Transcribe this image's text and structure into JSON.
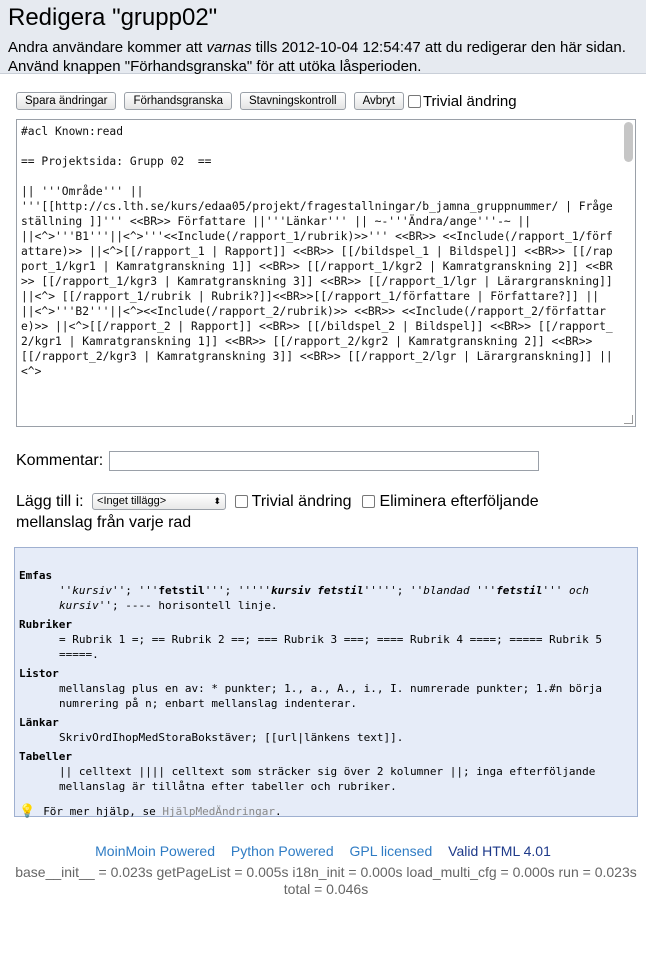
{
  "header": {
    "title": "Redigera \"grupp02\"",
    "notice_pre": "Andra användare kommer att ",
    "notice_em": "varnas",
    "notice_post": " tills 2012-10-04 12:54:47 att du redigerar den här sidan. Använd knappen \"Förhandsgranska\" för att utöka låsperioden."
  },
  "toolbar": {
    "save": "Spara ändringar",
    "preview": "Förhandsgranska",
    "spellcheck": "Stavningskontroll",
    "cancel": "Avbryt",
    "trivial": "Trivial ändring"
  },
  "editor": {
    "content": "#acl Known:read\n\n== Projektsida: Grupp 02  ==\n\n|| '''Område''' ||\n'''[[http://cs.lth.se/kurs/edaa05/projekt/fragestallningar/b_jamna_gruppnummer/ | Frågeställning ]]''' <<BR>> Författare ||'''Länkar''' || ~-'''Ändra/ange'''-~ ||\n||<^>'''B1'''||<^>'''<<Include(/rapport_1/rubrik)>>''' <<BR>> <<Include(/rapport_1/författare)>> ||<^>[[/rapport_1 | Rapport]] <<BR>> [[/bildspel_1 | Bildspel]] <<BR>> [[/rapport_1/kgr1 | Kamratgranskning 1]] <<BR>> [[/rapport_1/kgr2 | Kamratgranskning 2]] <<BR>> [[/rapport_1/kgr3 | Kamratgranskning 3]] <<BR>> [[/rapport_1/lgr | Lärargranskning]] ||<^> [[/rapport_1/rubrik | Rubrik?]]<<BR>>[[/rapport_1/författare | Författare?]] ||\n||<^>'''B2'''||<^><<Include(/rapport_2/rubrik)>> <<BR>> <<Include(/rapport_2/författare)>> ||<^>[[/rapport_2 | Rapport]] <<BR>> [[/bildspel_2 | Bildspel]] <<BR>> [[/rapport_2/kgr1 | Kamratgranskning 1]] <<BR>> [[/rapport_2/kgr2 | Kamratgranskning 2]] <<BR>> [[/rapport_2/kgr3 | Kamratgranskning 3]] <<BR>> [[/rapport_2/lgr | Lärargranskning]] ||<^>"
  },
  "comment": {
    "label": "Kommentar:",
    "value": ""
  },
  "addto": {
    "label": "Lägg till i:",
    "selected": "<Inget tillägg>",
    "trivial": "Trivial ändring",
    "eliminate": "Eliminera efterföljande mellanslag från varje rad"
  },
  "help": {
    "emphasis_title": "Emfas",
    "emphasis_1": "''kursiv''",
    "emphasis_2": "; '''",
    "emphasis_3": "fetstil",
    "emphasis_4": "'''; '''''",
    "emphasis_5": "kursiv fetstil",
    "emphasis_6": "'''''; ''",
    "emphasis_7": "blandad '''",
    "emphasis_8": "fetstil",
    "emphasis_9": "''' och kursiv",
    "emphasis_10": "''; ---- horisontell linje.",
    "headings_title": "Rubriker",
    "headings_text": "= Rubrik 1 =; == Rubrik 2 ==; === Rubrik 3 ===; ==== Rubrik 4 ====; ===== Rubrik 5 =====.",
    "lists_title": "Listor",
    "lists_text": "mellanslag plus en av: * punkter; 1., a., A., i., I. numrerade punkter; 1.#n börja numrering på n; enbart mellanslag indenterar.",
    "links_title": "Länkar",
    "links_text": "SkrivOrdIhopMedStoraBokstäver; [[url|länkens text]].",
    "tables_title": "Tabeller",
    "tables_text": "|| celltext |||| celltext som sträcker sig över 2 kolumner ||; inga efterföljande mellanslag är tillåtna efter tabeller och rubriker.",
    "tip_pre": "För mer hjälp, se ",
    "tip_link": "HjälpMedÄndringar",
    "tip_post": "."
  },
  "footer": {
    "moinmoin": "MoinMoin Powered",
    "python": "Python Powered",
    "gpl": "GPL licensed",
    "valid": "Valid HTML 4.01",
    "timing": "base__init__ = 0.023s   getPageList = 0.005s   i18n_init = 0.000s   load_multi_cfg = 0.000s   run = 0.023s   total = 0.046s"
  }
}
